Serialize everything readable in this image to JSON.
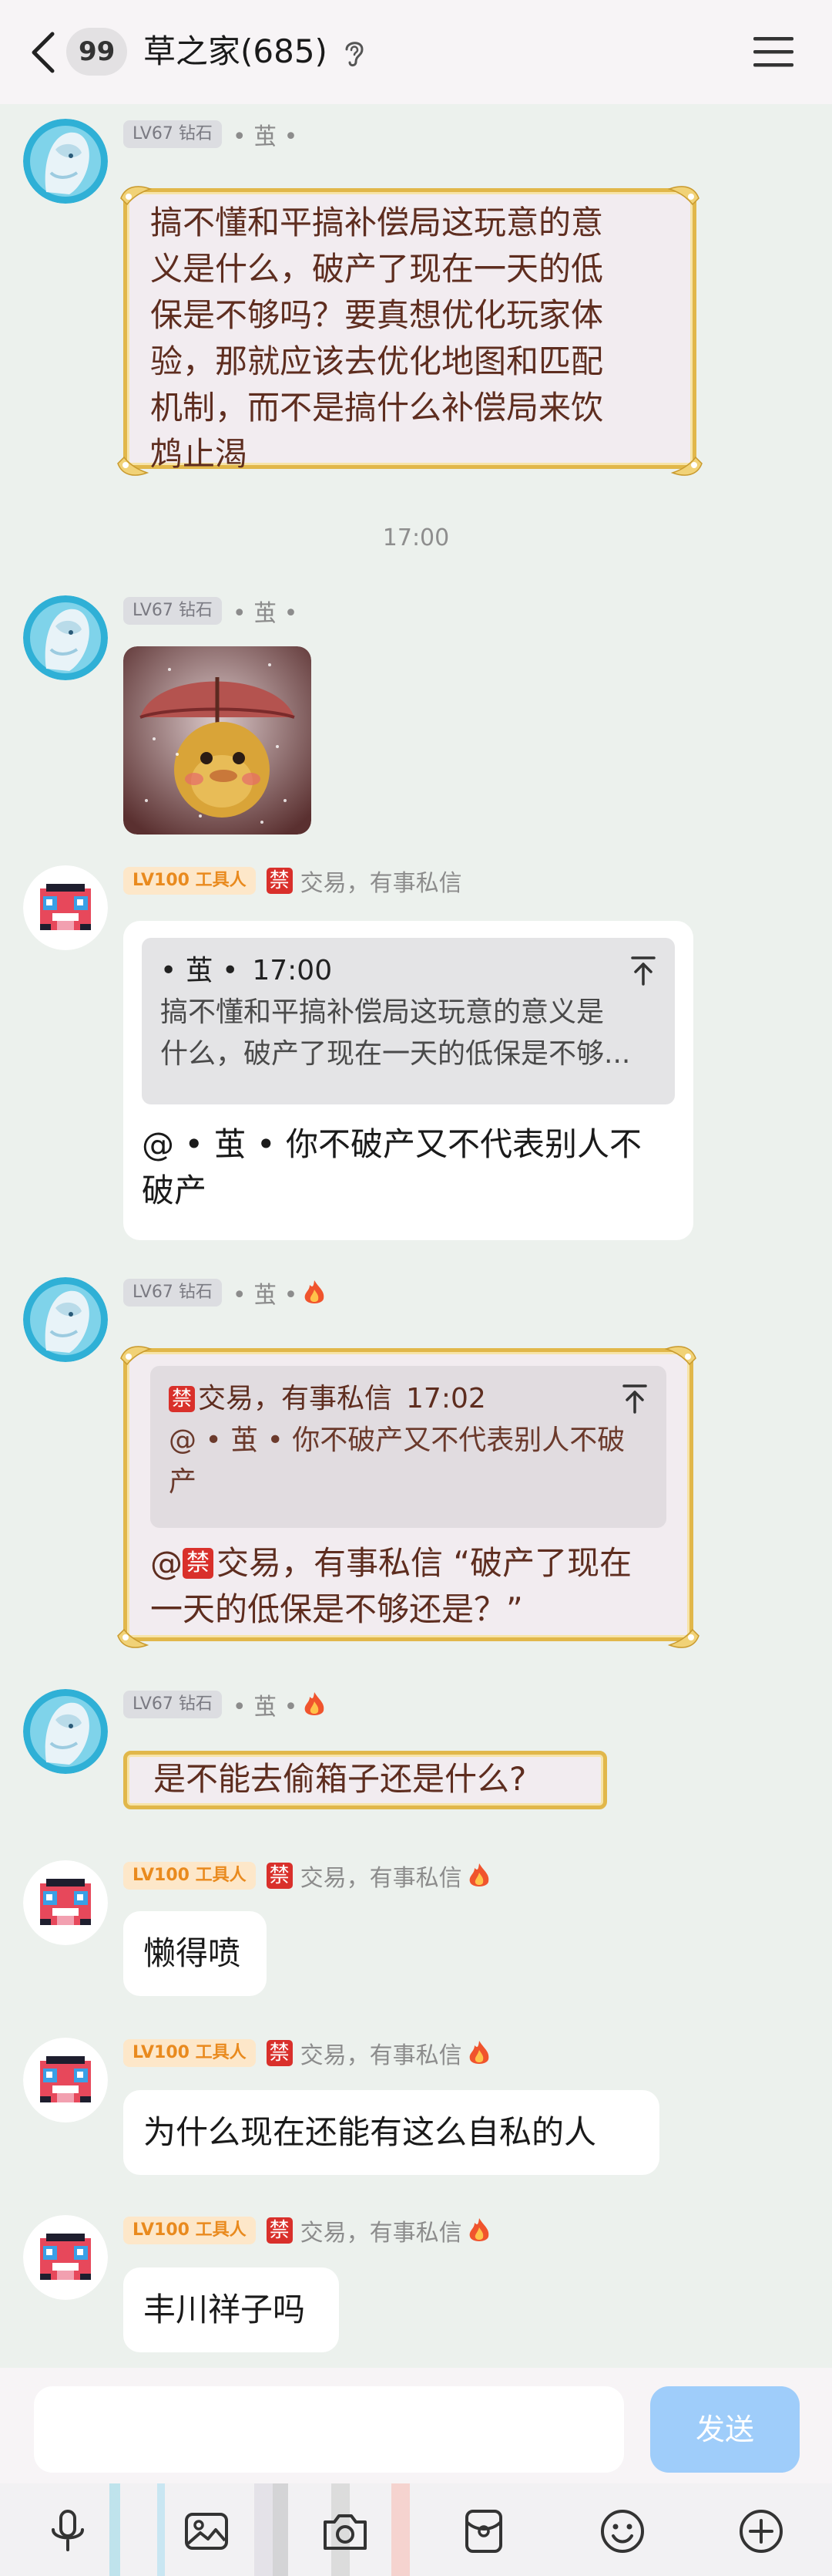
{
  "header": {
    "back_label": "",
    "unread_count": "99",
    "group_name": "草之家(685)"
  },
  "messages": [
    {
      "level": "LV67 钻石",
      "nickname": "• 茧 •",
      "text_lines": [
        "搞不懂和平搞补偿局这玩意的意",
        "义是什么，破产了现在一天的低",
        "保是不够吗？要真想优化玩家体",
        "验，那就应该去优化地图和匹配",
        "机制，而不是搞什么补偿局来饮",
        "鸩止渴"
      ]
    },
    {
      "time": "17:00"
    },
    {
      "level": "LV67 钻石",
      "nickname": "• 茧 •",
      "sticker": "umbrella-duck-sticker"
    },
    {
      "level": "LV100 工具人",
      "ban_glyph": "禁",
      "nickname": "交易，有事私信",
      "quote": {
        "author": "• 茧 •",
        "time": "17:00",
        "text_lines": [
          "搞不懂和平搞补偿局这玩意的意义是",
          "什么，破产了现在一天的低保是不够..."
        ]
      },
      "text_lines": [
        "@ • 茧 •  你不破产又不代表别人不",
        "破产"
      ]
    },
    {
      "level": "LV67 钻石",
      "nickname": "• 茧 •",
      "quote": {
        "ban_glyph": "禁",
        "author": "交易，有事私信",
        "time": "17:02",
        "text_lines": [
          "@ • 茧 •  你不破产又不代表别人不破",
          "产"
        ]
      },
      "text_prefix": "@",
      "ban_glyph": "禁",
      "text_lines": [
        "交易，有事私信 “破产了现在",
        "一天的低保是不够还是？”"
      ]
    },
    {
      "level": "LV67 钻石",
      "nickname": "• 茧 •",
      "text": "是不能去偷箱子还是什么?"
    },
    {
      "level": "LV100 工具人",
      "ban_glyph": "禁",
      "nickname": "交易，有事私信",
      "text": "懒得喷"
    },
    {
      "level": "LV100 工具人",
      "ban_glyph": "禁",
      "nickname": "交易，有事私信",
      "text": "为什么现在还能有这么自私的人"
    },
    {
      "level": "LV100 工具人",
      "ban_glyph": "禁",
      "nickname": "交易，有事私信",
      "text": "丰川祥子吗"
    }
  ],
  "input": {
    "placeholder": "",
    "send_label": "发送"
  },
  "toolbar": {
    "icons": [
      "microphone-icon",
      "image-icon",
      "camera-icon",
      "red-packet-icon",
      "emoji-icon",
      "plus-icon"
    ]
  },
  "colors": {
    "background": "#ecf1ed",
    "gold_frame": "#e1b74a",
    "send_button": "#9fcdfa",
    "level_gold_text": "#e98a1e",
    "ban_red": "#d9302b"
  }
}
